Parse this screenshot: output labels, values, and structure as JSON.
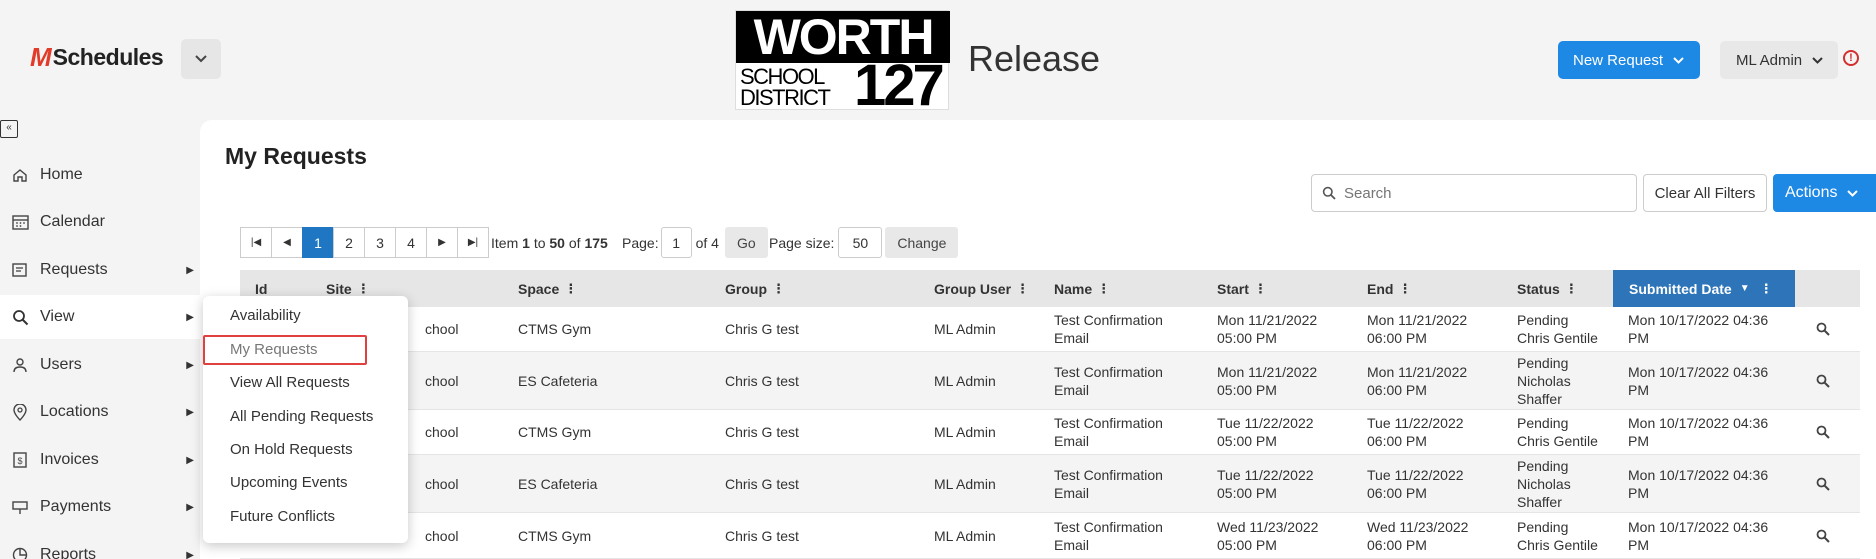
{
  "header": {
    "app_logo": "Schedules",
    "brand": {
      "top": "WORTH",
      "middle_line1": "SCHOOL",
      "middle_line2": "DISTRICT",
      "number": "127"
    },
    "env": "Release",
    "new_request": "New Request",
    "user": "ML Admin"
  },
  "sidebar": {
    "items": [
      {
        "label": "Home",
        "icon": "home-icon"
      },
      {
        "label": "Calendar",
        "icon": "calendar-icon"
      },
      {
        "label": "Requests",
        "icon": "requests-icon"
      },
      {
        "label": "View",
        "icon": "search-icon"
      },
      {
        "label": "Users",
        "icon": "users-icon"
      },
      {
        "label": "Locations",
        "icon": "location-icon"
      },
      {
        "label": "Invoices",
        "icon": "invoice-icon"
      },
      {
        "label": "Payments",
        "icon": "payment-icon"
      },
      {
        "label": "Reports",
        "icon": "reports-icon"
      }
    ]
  },
  "view_menu": {
    "items": [
      "Availability",
      "My Requests",
      "View All Requests",
      "All Pending Requests",
      "On Hold Requests",
      "Upcoming Events",
      "Future Conflicts"
    ],
    "selected": "My Requests"
  },
  "main": {
    "title": "My Requests",
    "search_placeholder": "Search",
    "clear_filters": "Clear All Filters",
    "actions": "Actions"
  },
  "pager": {
    "pages": [
      "1",
      "2",
      "3",
      "4"
    ],
    "current": "1",
    "item_label": "Item",
    "from": "1",
    "to_label": "to",
    "to": "50",
    "of_label": "of",
    "total": "175",
    "page_label": "Page:",
    "page_value": "1",
    "of_pages": "of 4",
    "go": "Go",
    "page_size_label": "Page size:",
    "page_size": "50",
    "change": "Change"
  },
  "table": {
    "columns": [
      "Id",
      "Site",
      "Space",
      "Group",
      "Group User",
      "Name",
      "Start",
      "End",
      "Status",
      "Submitted Date"
    ],
    "sorted_column": "Submitted Date",
    "rows": [
      {
        "site": "chool",
        "space": "CTMS Gym",
        "group": "Chris G test",
        "group_user": "ML Admin",
        "name": [
          "Test Confirmation",
          "Email"
        ],
        "start": [
          "Mon 11/21/2022",
          "05:00 PM"
        ],
        "end": [
          "Mon 11/21/2022",
          "06:00 PM"
        ],
        "status": [
          "Pending",
          "Chris Gentile"
        ],
        "submitted": [
          "Mon 10/17/2022 04:36",
          "PM"
        ]
      },
      {
        "site": "chool",
        "space": "ES Cafeteria",
        "group": "Chris G test",
        "group_user": "ML Admin",
        "name": [
          "Test Confirmation",
          "Email"
        ],
        "start": [
          "Mon 11/21/2022",
          "05:00 PM"
        ],
        "end": [
          "Mon 11/21/2022",
          "06:00 PM"
        ],
        "status": [
          "Pending",
          "Nicholas",
          "Shaffer"
        ],
        "submitted": [
          "Mon 10/17/2022 04:36",
          "PM"
        ]
      },
      {
        "site": "chool",
        "space": "CTMS Gym",
        "group": "Chris G test",
        "group_user": "ML Admin",
        "name": [
          "Test Confirmation",
          "Email"
        ],
        "start": [
          "Tue 11/22/2022",
          "05:00 PM"
        ],
        "end": [
          "Tue 11/22/2022",
          "06:00 PM"
        ],
        "status": [
          "Pending",
          "Chris Gentile"
        ],
        "submitted": [
          "Mon 10/17/2022 04:36",
          "PM"
        ]
      },
      {
        "site": "chool",
        "space": "ES Cafeteria",
        "group": "Chris G test",
        "group_user": "ML Admin",
        "name": [
          "Test Confirmation",
          "Email"
        ],
        "start": [
          "Tue 11/22/2022",
          "05:00 PM"
        ],
        "end": [
          "Tue 11/22/2022",
          "06:00 PM"
        ],
        "status": [
          "Pending",
          "Nicholas",
          "Shaffer"
        ],
        "submitted": [
          "Mon 10/17/2022 04:36",
          "PM"
        ]
      },
      {
        "site": "chool",
        "space": "CTMS Gym",
        "group": "Chris G test",
        "group_user": "ML Admin",
        "name": [
          "Test Confirmation",
          "Email"
        ],
        "start": [
          "Wed 11/23/2022",
          "05:00 PM"
        ],
        "end": [
          "Wed 11/23/2022",
          "06:00 PM"
        ],
        "status": [
          "Pending",
          "Chris Gentile"
        ],
        "submitted": [
          "Mon 10/17/2022 04:36",
          "PM"
        ]
      }
    ]
  },
  "colors": {
    "primary": "#1e88e5",
    "sorted_header": "#2e74b8",
    "highlight": "#e04040",
    "logo_mark": "#e23b2a"
  }
}
